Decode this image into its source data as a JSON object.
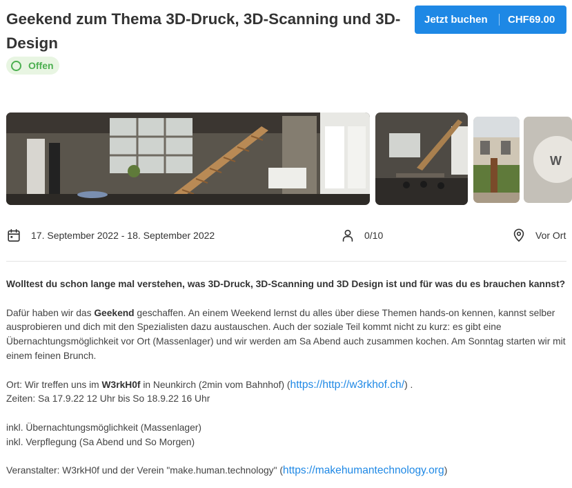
{
  "header": {
    "title": "Geekend zum Thema 3D-Druck, 3D-Scanning und 3D-Design",
    "status": "Offen"
  },
  "booking": {
    "button_label": "Jetzt buchen",
    "price": "CHF69.00"
  },
  "gallery": {
    "images": [
      "workshop-hall-staircase",
      "workshop-hall-chairs",
      "garden-building",
      "w3rkh0f-sign"
    ]
  },
  "meta": {
    "date": "17. September 2022 - 18. September 2022",
    "participants": "0/10",
    "location": "Vor Ort",
    "icons": [
      "calendar-icon",
      "person-icon",
      "location-pin-icon"
    ]
  },
  "description": {
    "lead": "Wolltest du schon lange mal verstehen, was 3D-Druck, 3D-Scanning und 3D Design ist und für was du es brauchen kannst?",
    "p1_before": "Dafür haben wir das ",
    "p1_bold": "Geekend",
    "p1_after": " geschaffen. An einem Weekend lernst du alles über diese Themen hands-on kennen, kannst selber ausprobieren und dich mit den Spezialisten dazu austauschen. Auch der soziale Teil kommt nicht zu kurz: es gibt eine Übernachtungsmöglichkeit vor Ort (Massenlager) und wir werden am Sa Abend auch zusammen kochen. Am Sonntag starten wir mit einem feinen Brunch.",
    "ort_before": "Ort: Wir treffen uns im ",
    "ort_bold": "W3rkH0f",
    "ort_mid": " in Neunkirch (2min vom Bahnhof) (",
    "ort_link": "https://http://w3rkhof.ch/",
    "ort_after": ") .",
    "zeiten": "Zeiten: Sa 17.9.22 12 Uhr bis So 18.9.22 16 Uhr",
    "incl1": "inkl. Übernachtungsmöglichkeit (Massenlager)",
    "incl2": "inkl. Verpflegung (Sa Abend und So Morgen)",
    "org_before": "Veranstalter: W3rkH0f und der Verein \"make.human.technology\" (",
    "org_link": "https://makehumantechnology.org",
    "org_after": ")"
  },
  "colors": {
    "accent": "#1e88e5",
    "status_green": "#4caf50",
    "status_bg": "#e8f5e2"
  }
}
